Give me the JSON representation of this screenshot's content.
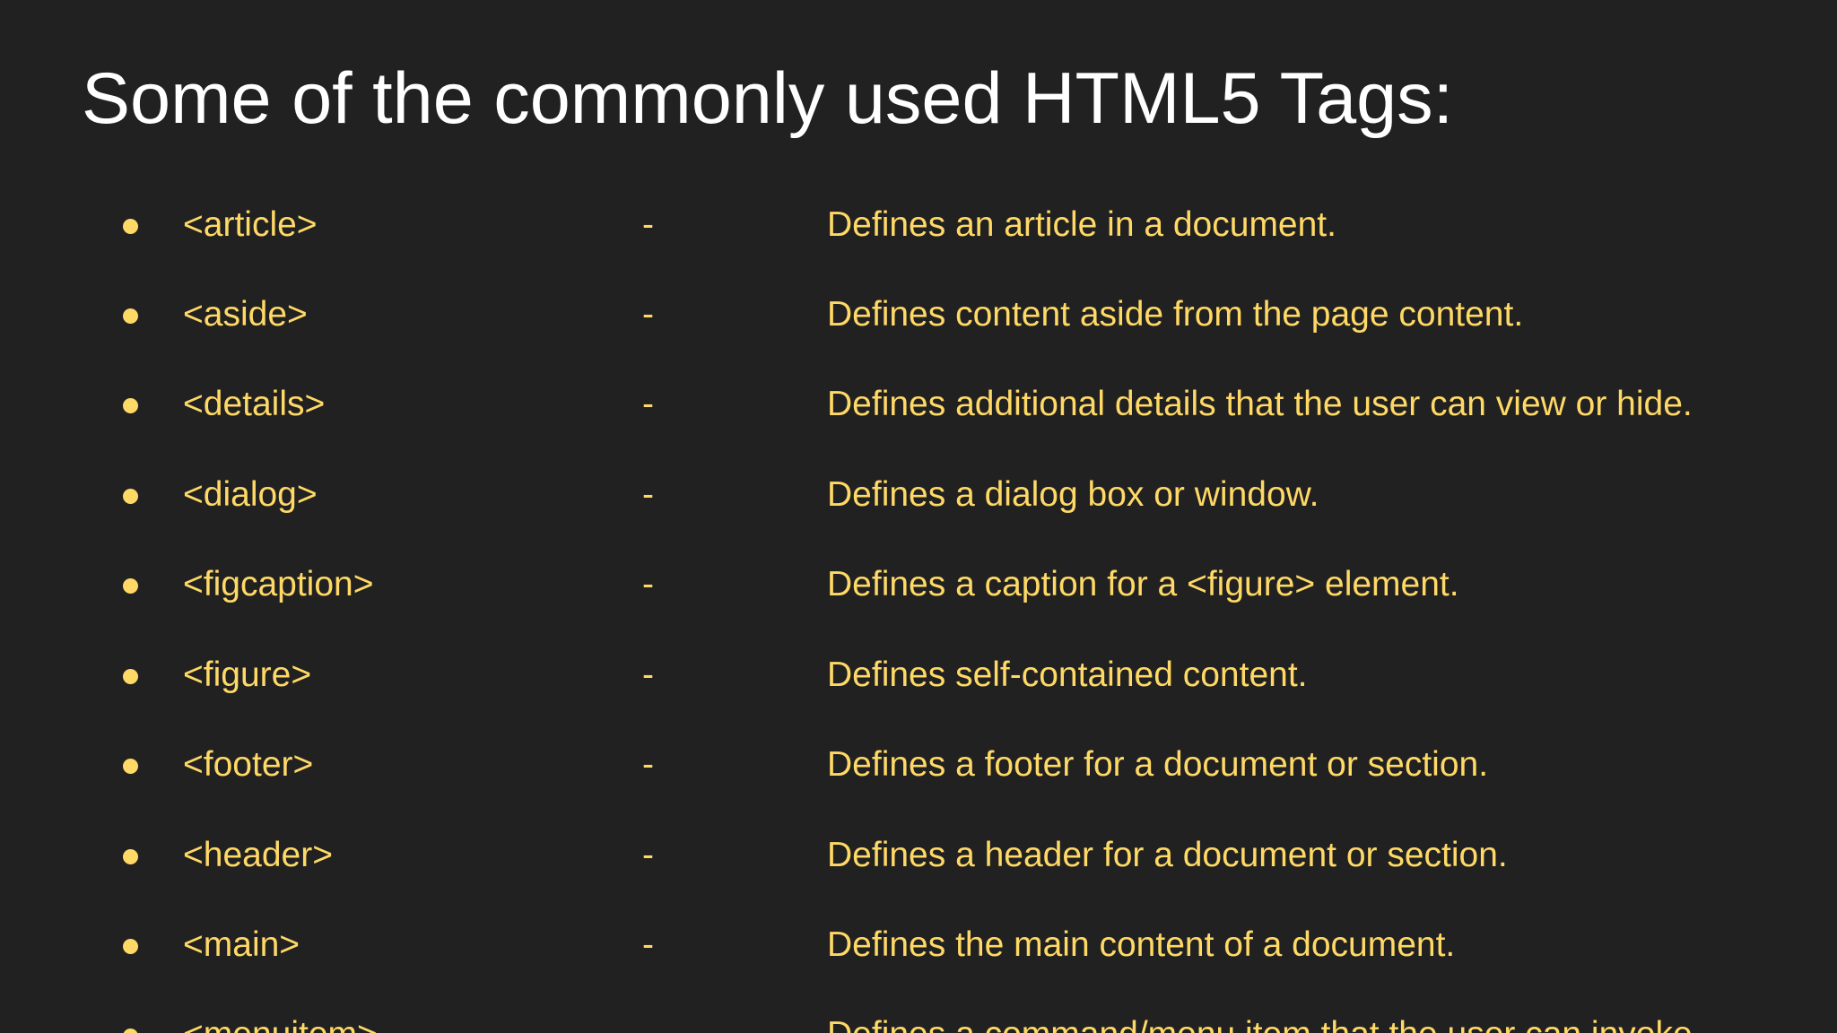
{
  "slide": {
    "title": "Some of the commonly used HTML5 Tags:",
    "text_color": "#ffd966",
    "title_color": "#ffffff",
    "background": "#212121",
    "items": [
      {
        "tag": "<article>",
        "separator": "-",
        "description": "Defines an article in a document."
      },
      {
        "tag": "<aside>",
        "separator": "-",
        "description": "Defines content aside from the page content."
      },
      {
        "tag": "<details>",
        "separator": "-",
        "description": "Defines additional details that the user can view or hide."
      },
      {
        "tag": "<dialog>",
        "separator": "-",
        "description": "Defines a dialog box or window."
      },
      {
        "tag": "<figcaption>",
        "separator": "-",
        "description": "Defines a caption for a <figure> element."
      },
      {
        "tag": "<figure>",
        "separator": "-",
        "description": "Defines self-contained content."
      },
      {
        "tag": "<footer>",
        "separator": "-",
        "description": "Defines a footer for a document or section."
      },
      {
        "tag": "<header>",
        "separator": "-",
        "description": "Defines a header for a document or section."
      },
      {
        "tag": "<main>",
        "separator": "-",
        "description": "Defines the main content of a document."
      },
      {
        "tag": "<menuitem>",
        "separator": "-",
        "description": "Defines a command/menu item that the user can invoke"
      }
    ]
  }
}
